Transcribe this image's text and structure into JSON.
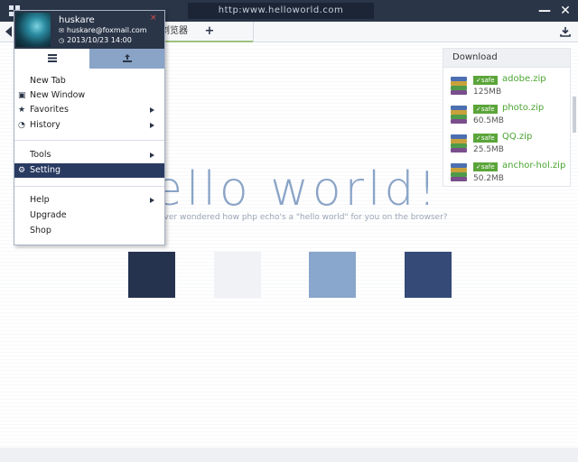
{
  "titlebar": {
    "url": "http:www.helloworld.com",
    "minimize_icon": "minimize-icon",
    "close_icon": "close-icon"
  },
  "tabbar": {
    "tab_label": "浏览器",
    "add_tab_label": "+"
  },
  "menu": {
    "user": {
      "name": "huskare",
      "email": "huskare@foxmail.com",
      "datetime": "2013/10/23  14:00"
    },
    "close_label": "×",
    "items": {
      "new_tab": "New Tab",
      "new_window": "New Window",
      "favorites": "Favorites",
      "history": "History",
      "tools": "Tools",
      "setting": "Setting",
      "help": "Help",
      "upgrade": "Upgrade",
      "shop": "Shop"
    }
  },
  "page": {
    "headline": "ello world",
    "headline_bang": "!",
    "subtitle": "ever wondered how php echo's a \"hello world\" for you on the browser?",
    "swatch_colors": [
      "#26334f",
      "#f0f2f6",
      "#89a6cc",
      "#354a77"
    ]
  },
  "download": {
    "title": "Download",
    "badge": "safe",
    "files": [
      {
        "name": "adobe.zip",
        "size": "125MB"
      },
      {
        "name": "photo.zip",
        "size": "60.5MB"
      },
      {
        "name": "QQ.zip",
        "size": "25.5MB"
      },
      {
        "name": "anchor-hol.zip",
        "size": "50.2MB"
      }
    ]
  },
  "colors": {
    "titlebar": "#2a3548",
    "accent": "#8aa4c7",
    "selected": "#2a3b62",
    "safe_green": "#4aa531"
  }
}
